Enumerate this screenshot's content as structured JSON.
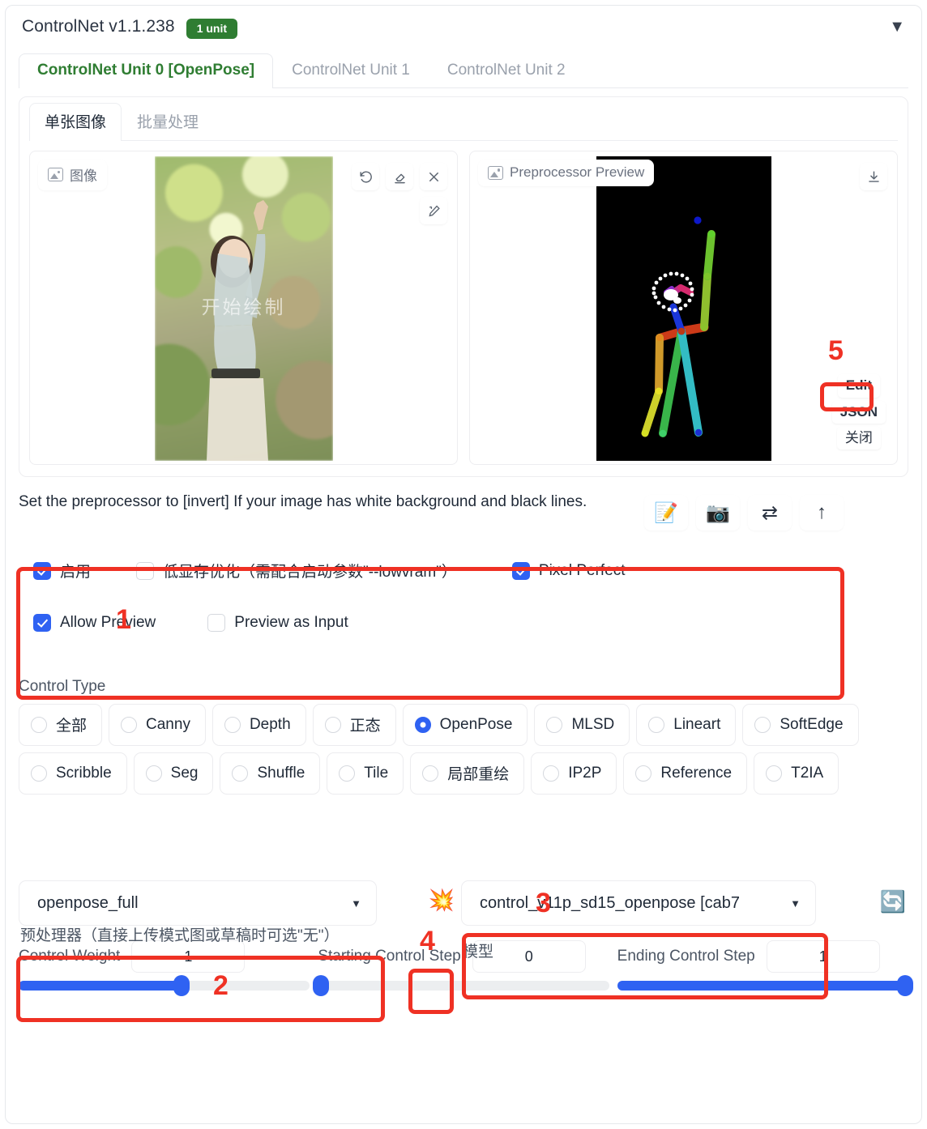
{
  "header": {
    "app_title": "ControlNet v1.1.238",
    "unit_badge": "1 unit",
    "collapse_icon": "caret-down-icon"
  },
  "unit_tabs": [
    {
      "label": "ControlNet Unit 0 [OpenPose]",
      "active": true
    },
    {
      "label": "ControlNet Unit 1",
      "active": false
    },
    {
      "label": "ControlNet Unit 2",
      "active": false
    }
  ],
  "sub_tabs": [
    {
      "label": "单张图像",
      "active": true
    },
    {
      "label": "批量处理",
      "active": false
    }
  ],
  "image_panel": {
    "chip_label": "图像",
    "watermark": "开始绘制",
    "tools": [
      {
        "name": "undo-icon",
        "glyph": "↺"
      },
      {
        "name": "eraser-icon",
        "glyph": "◇"
      },
      {
        "name": "close-icon",
        "glyph": "✕"
      }
    ],
    "brush_tool": {
      "name": "brush-icon",
      "glyph": "✎"
    }
  },
  "preview_panel": {
    "chip_label": "Preprocessor Preview",
    "download_icon": "download-icon",
    "buttons": [
      {
        "label": "Edit",
        "highlighted": true
      },
      {
        "label": "JSON",
        "highlighted": false
      },
      {
        "label": "关闭",
        "highlighted": false
      }
    ]
  },
  "hint": {
    "text": "Set the preprocessor to [invert] If your image has white background and black lines.",
    "icons": [
      {
        "name": "memo-icon",
        "glyph": "📝"
      },
      {
        "name": "camera-icon",
        "glyph": "📷"
      },
      {
        "name": "swap-arrows-icon",
        "glyph": "⇄"
      },
      {
        "name": "arrow-up-icon",
        "glyph": "↑"
      }
    ]
  },
  "options": {
    "row1": [
      {
        "label": "启用",
        "checked": true
      },
      {
        "label": "低显存优化（需配合启动参数\"--lowvram\"）",
        "checked": false
      },
      {
        "label": "Pixel Perfect",
        "checked": true
      }
    ],
    "row2": [
      {
        "label": "Allow Preview",
        "checked": true
      },
      {
        "label": "Preview as Input",
        "checked": false
      }
    ]
  },
  "control_type": {
    "label": "Control Type",
    "selected": "OpenPose",
    "options": [
      {
        "label": "全部",
        "selected": false
      },
      {
        "label": "Canny",
        "selected": false
      },
      {
        "label": "Depth",
        "selected": false
      },
      {
        "label": "正态",
        "selected": false
      },
      {
        "label": "OpenPose",
        "selected": true
      },
      {
        "label": "MLSD",
        "selected": false
      },
      {
        "label": "Lineart",
        "selected": false
      },
      {
        "label": "SoftEdge",
        "selected": false
      },
      {
        "label": "Scribble",
        "selected": false
      },
      {
        "label": "Seg",
        "selected": false
      },
      {
        "label": "Shuffle",
        "selected": false
      },
      {
        "label": "Tile",
        "selected": false
      },
      {
        "label": "局部重绘",
        "selected": false
      },
      {
        "label": "IP2P",
        "selected": false
      },
      {
        "label": "Reference",
        "selected": false
      },
      {
        "label": "T2IA",
        "selected": false
      }
    ]
  },
  "preprocessor": {
    "label": "预处理器（直接上传模式图或草稿时可选\"无\"）",
    "value": "openpose_full",
    "caret": "chevron-down-icon"
  },
  "model": {
    "label": "模型",
    "value": "control_v11p_sd15_openpose [cab7",
    "caret": "chevron-down-icon"
  },
  "burst_button": {
    "name": "explosion-icon",
    "glyph": "💥"
  },
  "refresh_button": {
    "name": "refresh-icon",
    "glyph": "🔄"
  },
  "sliders": [
    {
      "name": "Control Weight",
      "value": "1",
      "percent": 56
    },
    {
      "name": "Starting Control Step",
      "value": "0",
      "percent": 0
    },
    {
      "name": "Ending Control Step",
      "value": "1",
      "percent": 100
    }
  ],
  "annotations": [
    {
      "number": "1"
    },
    {
      "number": "2"
    },
    {
      "number": "3"
    },
    {
      "number": "4"
    },
    {
      "number": "5"
    }
  ]
}
